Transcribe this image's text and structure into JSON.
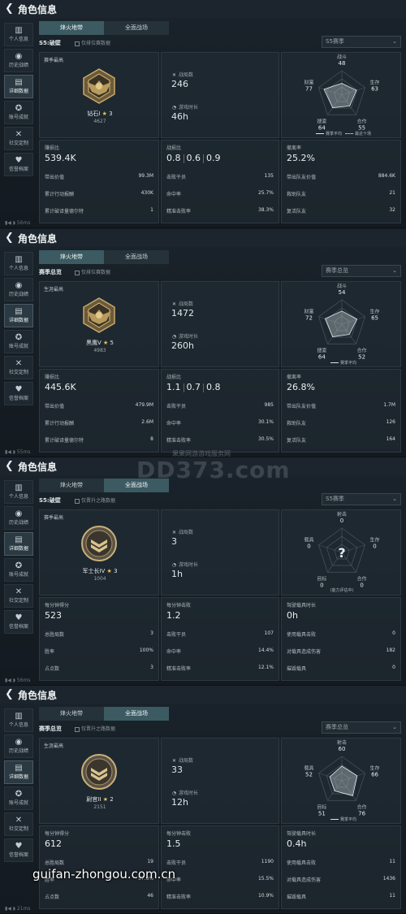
{
  "app": {
    "title": "角色信息",
    "back_icon": "chevron-left-icon"
  },
  "sidebar": [
    "个人信息",
    "历史战绩",
    "详细数据",
    "账号成就",
    "社交定制",
    "信誉档案"
  ],
  "colors": {
    "accent": "#3b5a62",
    "panel": "#1a232b",
    "star": "#e3c261"
  },
  "panels": [
    {
      "status": "▮◀ ◗ 56ms",
      "tabs": {
        "tab1": "烽火地带",
        "tab2": "全面战场",
        "active": 1
      },
      "season": "S5:破壁",
      "filter_label": "仅排位赛数据",
      "dropdown": "S5赛季",
      "rank_caption": "赛季最高",
      "rank": {
        "name": "钻石I",
        "stars": "3",
        "points": "4627"
      },
      "metric1": {
        "label": "战局数",
        "value": "246"
      },
      "metric2": {
        "label": "游戏时长",
        "value": "46h"
      },
      "radar": {
        "labels": [
          "战斗",
          "生存",
          "合作",
          "搜索",
          "财富"
        ],
        "values": [
          "48",
          "63",
          "55",
          "64",
          "77"
        ],
        "scores": [
          0.48,
          0.63,
          0.55,
          0.64,
          0.77
        ],
        "legend1": "赛季平均",
        "legend2": "最近十场"
      },
      "s1": {
        "label": "赚损比",
        "value": "539.4K",
        "rows": [
          [
            "带出价值",
            "99.3M"
          ],
          [
            "累计行动报酬",
            "430K"
          ],
          [
            "累计破译量德尔特",
            "1"
          ]
        ]
      },
      "s2": {
        "label": "战损比",
        "kda": [
          "0.8",
          "0.6",
          "0.9"
        ],
        "rows": [
          [
            "击败干员",
            "135"
          ],
          [
            "命中率",
            "25.7%"
          ],
          [
            "精准击败率",
            "38.3%"
          ]
        ]
      },
      "s3": {
        "label": "撤离率",
        "value": "25.2%",
        "rows": [
          [
            "带出队友价值",
            "884.6K"
          ],
          [
            "救助队友",
            "21"
          ],
          [
            "复活队友",
            "32"
          ]
        ]
      }
    },
    {
      "status": "▮◀ ◗ 55ms",
      "tabs": {
        "tab1": "烽火地带",
        "tab2": "全面战场",
        "active": 1
      },
      "season": "赛季总览",
      "filter_label": "仅排位赛数据",
      "dropdown": "赛季总览",
      "rank_caption": "生涯最高",
      "rank": {
        "name": "黑鹰V",
        "stars": "5",
        "points": "4983"
      },
      "metric1": {
        "label": "战局数",
        "value": "1472"
      },
      "metric2": {
        "label": "游戏时长",
        "value": "260h"
      },
      "radar": {
        "labels": [
          "战斗",
          "生存",
          "合作",
          "搜索",
          "财富"
        ],
        "values": [
          "54",
          "65",
          "52",
          "64",
          "72"
        ],
        "scores": [
          0.54,
          0.65,
          0.52,
          0.64,
          0.72
        ],
        "legend1": "赛季平均",
        "legend2": ""
      },
      "s1": {
        "label": "赚损比",
        "value": "445.6K",
        "rows": [
          [
            "带出价值",
            "479.9M"
          ],
          [
            "累计行动报酬",
            "2.6M"
          ],
          [
            "累计破译量德尔特",
            "8"
          ]
        ]
      },
      "s2": {
        "label": "战损比",
        "kda": [
          "1.1",
          "0.7",
          "0.8"
        ],
        "rows": [
          [
            "击败干员",
            "985"
          ],
          [
            "命中率",
            "30.1%"
          ],
          [
            "精准击败率",
            "30.5%"
          ]
        ]
      },
      "s3": {
        "label": "撤离率",
        "value": "26.8%",
        "rows": [
          [
            "带出队友价值",
            "1.7M"
          ],
          [
            "救助队友",
            "126"
          ],
          [
            "复活队友",
            "164"
          ]
        ]
      }
    },
    {
      "status": "▮◀ ◗ 56ms",
      "tabs": {
        "tab1": "烽火地带",
        "tab2": "全面战场",
        "active": 2
      },
      "season": "S5:破壁",
      "filter_label": "仅晋升之路数据",
      "dropdown": "S5赛季",
      "rank_caption": "赛季最高",
      "rank": {
        "name": "军士长IV",
        "stars": "3",
        "points": "1004"
      },
      "metric1": {
        "label": "战局数",
        "value": "3"
      },
      "metric2": {
        "label": "游戏时长",
        "value": "1h"
      },
      "radar": {
        "labels": [
          "射击",
          "生存",
          "合作",
          "目标",
          "载具"
        ],
        "values": [
          "0",
          "0",
          "0",
          "0",
          "0"
        ],
        "scores": [
          0,
          0,
          0,
          0,
          0
        ],
        "center_mark": "?",
        "legend1": "",
        "legend2": "",
        "note": "(能力评估中)"
      },
      "s1": {
        "label": "每分钟得分",
        "value": "523",
        "rows": [
          [
            "总胜局数",
            "3"
          ],
          [
            "胜率",
            "100%"
          ],
          [
            "占点数",
            "3"
          ]
        ]
      },
      "s2": {
        "label": "每分钟击败",
        "value": "1.2",
        "rows": [
          [
            "击败干员",
            "107"
          ],
          [
            "命中率",
            "14.4%"
          ],
          [
            "精准击败率",
            "12.1%"
          ]
        ]
      },
      "s3": {
        "label": "驾驶载具时长",
        "value": "0h",
        "rows": [
          [
            "使用载具击败",
            "0"
          ],
          [
            "对载具造成伤害",
            "182"
          ],
          [
            "摧毁载具",
            "0"
          ]
        ]
      }
    },
    {
      "status": "▮◀ ◗ 21ms",
      "tabs": {
        "tab1": "烽火地带",
        "tab2": "全面战场",
        "active": 2
      },
      "season": "赛季总览",
      "filter_label": "仅晋升之路数据",
      "dropdown": "赛季总览",
      "rank_caption": "生涯最高",
      "rank": {
        "name": "尉官II",
        "stars": "2",
        "points": "2151"
      },
      "metric1": {
        "label": "战局数",
        "value": "33"
      },
      "metric2": {
        "label": "游戏时长",
        "value": "12h"
      },
      "radar": {
        "labels": [
          "射击",
          "生存",
          "合作",
          "目标",
          "载具"
        ],
        "values": [
          "60",
          "66",
          "76",
          "51",
          "52"
        ],
        "scores": [
          0.6,
          0.66,
          0.76,
          0.51,
          0.52
        ],
        "legend1": "赛季平均",
        "legend2": ""
      },
      "s1": {
        "label": "每分钟得分",
        "value": "612",
        "rows": [
          [
            "总胜局数",
            "19"
          ],
          [
            "胜率",
            "57.6%"
          ],
          [
            "占点数",
            "46"
          ]
        ]
      },
      "s2": {
        "label": "每分钟击败",
        "value": "1.5",
        "rows": [
          [
            "击败干员",
            "1190"
          ],
          [
            "命中率",
            "15.5%"
          ],
          [
            "精准击败率",
            "10.9%"
          ]
        ]
      },
      "s3": {
        "label": "驾驶载具时长",
        "value": "0.4h",
        "rows": [
          [
            "使用载具击败",
            "11"
          ],
          [
            "对载具造成伤害",
            "1436"
          ],
          [
            "摧毁载具",
            "11"
          ]
        ]
      }
    }
  ],
  "watermark": {
    "small": "果果网游游戏服务网",
    "big": "DD373.com"
  },
  "credit": "guifan-zhongou.com.cn"
}
